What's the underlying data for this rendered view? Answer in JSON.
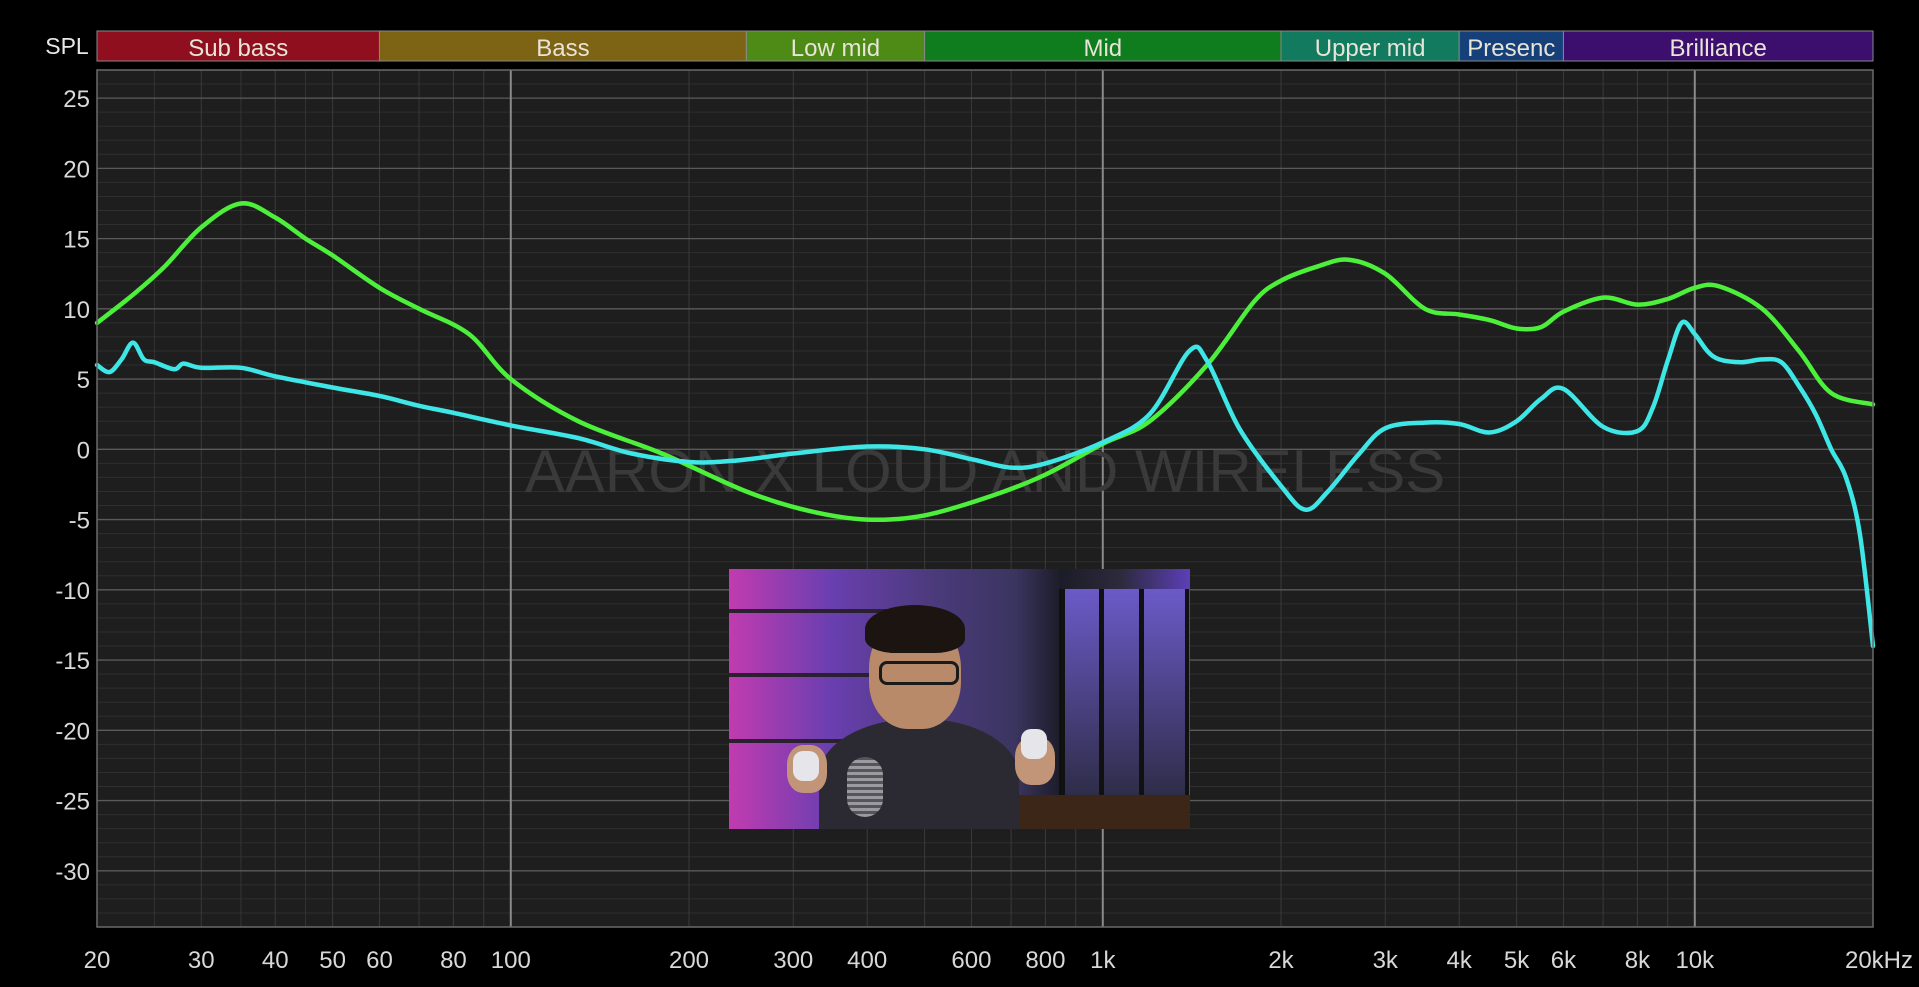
{
  "chart_data": {
    "type": "line",
    "ylabel": "SPL",
    "xunit": "Hz",
    "xscale": "log",
    "xlim": [
      20,
      20000
    ],
    "ylim": [
      -34,
      27
    ],
    "grid": true,
    "yticks": [
      25,
      20,
      15,
      10,
      5,
      0,
      -5,
      -10,
      -15,
      -20,
      -25,
      -30
    ],
    "xticks": [
      {
        "v": 20,
        "label": "20"
      },
      {
        "v": 30,
        "label": "30"
      },
      {
        "v": 40,
        "label": "40"
      },
      {
        "v": 50,
        "label": "50"
      },
      {
        "v": 60,
        "label": "60"
      },
      {
        "v": 80,
        "label": "80"
      },
      {
        "v": 100,
        "label": "100"
      },
      {
        "v": 200,
        "label": "200"
      },
      {
        "v": 300,
        "label": "300"
      },
      {
        "v": 400,
        "label": "400"
      },
      {
        "v": 600,
        "label": "600"
      },
      {
        "v": 800,
        "label": "800"
      },
      {
        "v": 1000,
        "label": "1k"
      },
      {
        "v": 2000,
        "label": "2k"
      },
      {
        "v": 3000,
        "label": "3k"
      },
      {
        "v": 4000,
        "label": "4k"
      },
      {
        "v": 5000,
        "label": "5k"
      },
      {
        "v": 6000,
        "label": "6k"
      },
      {
        "v": 8000,
        "label": "8k"
      },
      {
        "v": 10000,
        "label": "10k"
      },
      {
        "v": 20000,
        "label": "20kHz"
      }
    ],
    "bands": [
      {
        "label": "Sub bass",
        "from": 20,
        "to": 60,
        "color": "#8f0f1e"
      },
      {
        "label": "Bass",
        "from": 60,
        "to": 250,
        "color": "#7d6414"
      },
      {
        "label": "Low mid",
        "from": 250,
        "to": 500,
        "color": "#4d8a16"
      },
      {
        "label": "Mid",
        "from": 500,
        "to": 2000,
        "color": "#0f7c1e"
      },
      {
        "label": "Upper mid",
        "from": 2000,
        "to": 4000,
        "color": "#127a5e"
      },
      {
        "label": "Presenc",
        "from": 4000,
        "to": 6000,
        "color": "#16407a"
      },
      {
        "label": "Brilliance",
        "from": 6000,
        "to": 20000,
        "color": "#3c0f6e"
      }
    ],
    "watermark": "AARON X LOUD AND WIRELESS",
    "series": [
      {
        "color": "#4cf03a",
        "x": [
          20,
          23,
          26,
          30,
          35,
          40,
          45,
          50,
          60,
          70,
          85,
          100,
          130,
          180,
          250,
          320,
          400,
          500,
          650,
          800,
          1000,
          1200,
          1500,
          1800,
          2000,
          2300,
          2600,
          3000,
          3500,
          4000,
          4500,
          5000,
          5500,
          6000,
          7000,
          8000,
          9000,
          10000,
          11000,
          13000,
          15000,
          17000,
          20000
        ],
        "y": [
          9,
          11,
          13,
          15.8,
          17.5,
          16.5,
          15,
          13.8,
          11.5,
          10,
          8.2,
          5,
          2,
          -0.3,
          -3,
          -4.4,
          -5,
          -4.7,
          -3.3,
          -1.8,
          0.4,
          2,
          6,
          10.5,
          12,
          13,
          13.5,
          12.5,
          10,
          9.6,
          9.2,
          8.6,
          8.7,
          9.8,
          10.8,
          10.3,
          10.7,
          11.5,
          11.6,
          10,
          7,
          4,
          3.2
        ]
      },
      {
        "color": "#3ee6e6",
        "x": [
          20,
          21,
          22,
          23,
          24,
          25,
          27,
          28,
          30,
          35,
          40,
          50,
          60,
          70,
          80,
          100,
          130,
          160,
          200,
          240,
          300,
          400,
          500,
          600,
          700,
          800,
          1000,
          1200,
          1400,
          1500,
          1700,
          2000,
          2200,
          2400,
          2700,
          3000,
          3500,
          4000,
          4500,
          5000,
          5500,
          6000,
          7000,
          8000,
          8500,
          9000,
          9500,
          10000,
          10500,
          11000,
          12000,
          13000,
          14000,
          15000,
          16000,
          17000,
          18000,
          19000,
          20000
        ],
        "y": [
          6,
          5.5,
          6.4,
          7.6,
          6.4,
          6.2,
          5.7,
          6.1,
          5.8,
          5.8,
          5.2,
          4.4,
          3.8,
          3.1,
          2.6,
          1.7,
          0.8,
          -0.3,
          -0.9,
          -0.8,
          -0.3,
          0.2,
          0,
          -0.7,
          -1.3,
          -1,
          0.5,
          2.5,
          7,
          6.3,
          1.5,
          -2.6,
          -4.3,
          -3,
          -0.4,
          1.5,
          1.9,
          1.8,
          1.2,
          2,
          3.6,
          4.3,
          1.6,
          1.3,
          3,
          6.3,
          9,
          8.2,
          7,
          6.4,
          6.2,
          6.4,
          6.2,
          4.5,
          2.5,
          0,
          -2,
          -6,
          -14
        ]
      }
    ]
  }
}
